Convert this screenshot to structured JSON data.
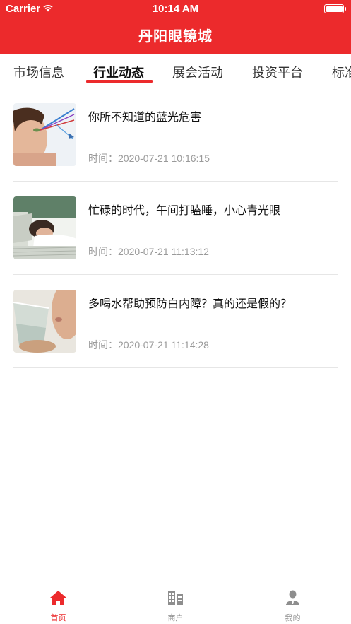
{
  "status_bar": {
    "carrier": "Carrier",
    "time": "10:14 AM"
  },
  "header": {
    "title": "丹阳眼镜城",
    "color": "#ec2a2c"
  },
  "category_tabs": [
    {
      "label": "市场信息",
      "active": false
    },
    {
      "label": "行业动态",
      "active": true
    },
    {
      "label": "展会活动",
      "active": false
    },
    {
      "label": "投资平台",
      "active": false
    },
    {
      "label": "标准",
      "active": false
    }
  ],
  "articles": [
    {
      "title": "你所不知道的蓝光危害",
      "time": "时间：2020-07-21 10:16:15",
      "image": "woman-blue-light-photo"
    },
    {
      "title": "忙碌的时代，午间打瞌睡，小心青光眼",
      "time": "时间：2020-07-21 11:13:12",
      "image": "sleeping-on-papers-photo"
    },
    {
      "title": "多喝水帮助预防白内障？真的还是假的？",
      "time": "时间：2020-07-21 11:14:28",
      "image": "drinking-water-photo"
    }
  ],
  "bottom_tabs": [
    {
      "label": "首页",
      "icon": "home-icon",
      "active": true
    },
    {
      "label": "商户",
      "icon": "building-icon",
      "active": false
    },
    {
      "label": "我的",
      "icon": "user-icon",
      "active": false
    }
  ]
}
